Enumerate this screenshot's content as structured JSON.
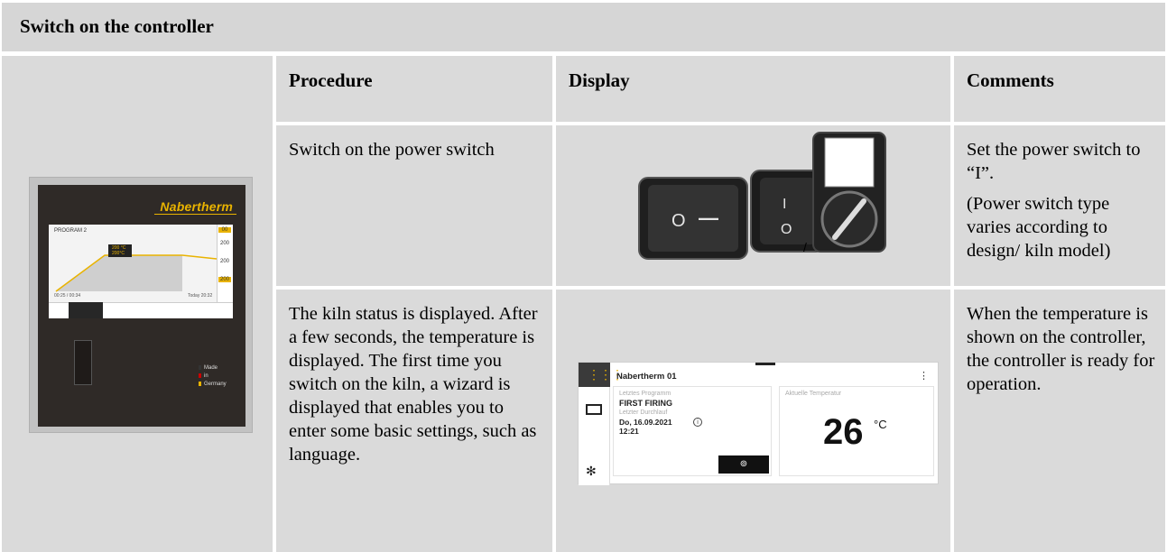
{
  "title": "Switch on the controller",
  "headers": {
    "procedure": "Procedure",
    "display": "Display",
    "comments": "Comments"
  },
  "controller_image": {
    "brand": "Nabertherm",
    "program": "PROGRAM 2",
    "setpoints": [
      "200 °C",
      "200°C"
    ],
    "side_values": [
      "00",
      "200",
      "200",
      "200"
    ],
    "footer_left": "00:25 / 00:34",
    "footer_right": "Today 20:32",
    "made_in": [
      "Made",
      "in",
      "Germany"
    ]
  },
  "rows": [
    {
      "procedure": "Switch on the power switch",
      "display": {
        "switch_labels": [
          "O",
          "—",
          "I",
          "O"
        ],
        "separator": "/"
      },
      "comments": [
        "Set the power switch to “I”.",
        "(Power switch type varies according to design/ kiln model)"
      ]
    },
    {
      "procedure": "The kiln status is displayed. After a few seconds, the temperature is displayed. The first time you switch on the kiln, a wizard is displayed that enables you to enter some basic settings, such as language.",
      "display": {
        "device_name": "Nabertherm 01",
        "last_program_label": "Letztes Programm",
        "last_program": "FIRST FIRING",
        "last_run_label": "Letzter Durchlauf",
        "last_run_date": "Do, 16.09.2021",
        "last_run_time": "12:21",
        "current_temp_label": "Aktuelle Temperatur",
        "current_temp": "26",
        "unit": "°C"
      },
      "comments": [
        "When the temperature is shown on the controller, the controller is ready for operation."
      ]
    }
  ],
  "colors": {
    "cell_bg": "#dadada",
    "title_bg": "#d6d6d6",
    "brand": "#e9b300",
    "panel_dark": "#2f2a27"
  }
}
